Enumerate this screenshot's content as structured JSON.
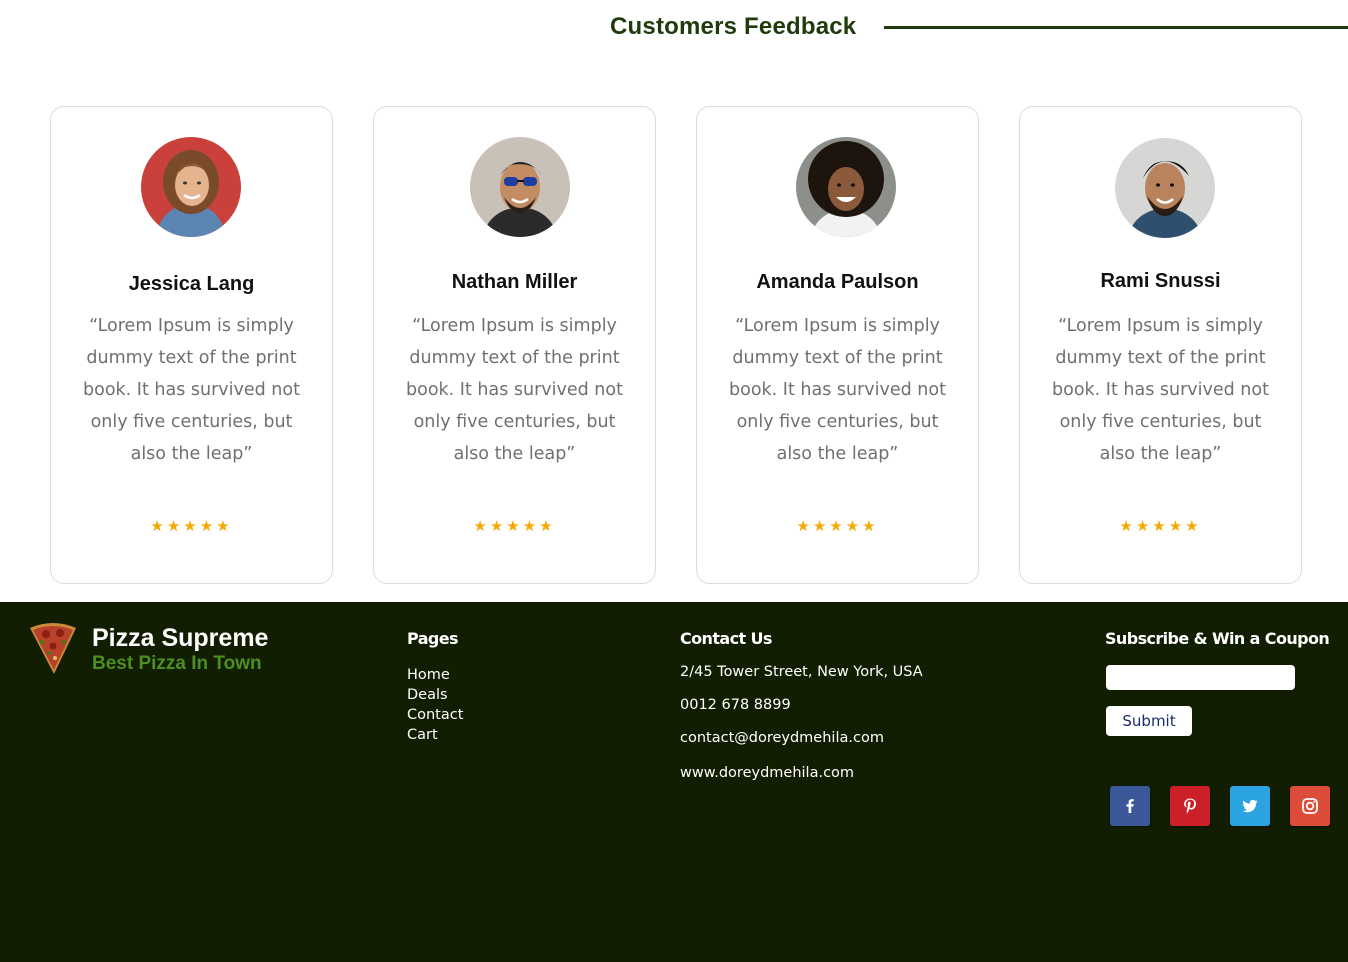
{
  "section": {
    "title": "Customers Feedback"
  },
  "testimonials": [
    {
      "name": "Jessica Lang",
      "quote": "“Lorem Ipsum is simply dummy text of the print book. It has survived not only five centuries, but also the leap”",
      "rating": 5
    },
    {
      "name": "Nathan Miller",
      "quote": "“Lorem Ipsum is simply dummy text of the print book. It has survived not only five centuries, but also the leap”",
      "rating": 5
    },
    {
      "name": "Amanda Paulson",
      "quote": "“Lorem Ipsum is simply dummy text of the print book. It has survived not only five centuries, but also the leap”",
      "rating": 5
    },
    {
      "name": "Rami Snussi",
      "quote": "“Lorem Ipsum is simply dummy text of the print book. It has survived not only five centuries, but also the leap”",
      "rating": 5
    }
  ],
  "footer": {
    "brand": {
      "name": "Pizza Supreme",
      "tagline": "Best Pizza In Town"
    },
    "pages": {
      "title": "Pages",
      "items": [
        "Home",
        "Deals",
        "Contact",
        "Cart"
      ]
    },
    "contact": {
      "title": "Contact Us",
      "address": "2/45 Tower Street, New York, USA",
      "phone": "0012 678 8899",
      "email": "contact@doreydmehila.com",
      "website": "www.doreydmehila.com"
    },
    "subscribe": {
      "title": "Subscribe & Win a Coupon",
      "input_value": "",
      "button_label": "Submit"
    },
    "social": [
      {
        "icon": "facebook-icon",
        "color": "#3b5998"
      },
      {
        "icon": "pinterest-icon",
        "color": "#cb2027"
      },
      {
        "icon": "twitter-icon",
        "color": "#2aa3e0"
      },
      {
        "icon": "instagram-icon",
        "color": "#dd4b39"
      }
    ]
  },
  "colors": {
    "accent_dark": "#1f3a0c",
    "footer_bg": "#121e02",
    "brand_green": "#4e8e20",
    "star": "#f5a800"
  }
}
